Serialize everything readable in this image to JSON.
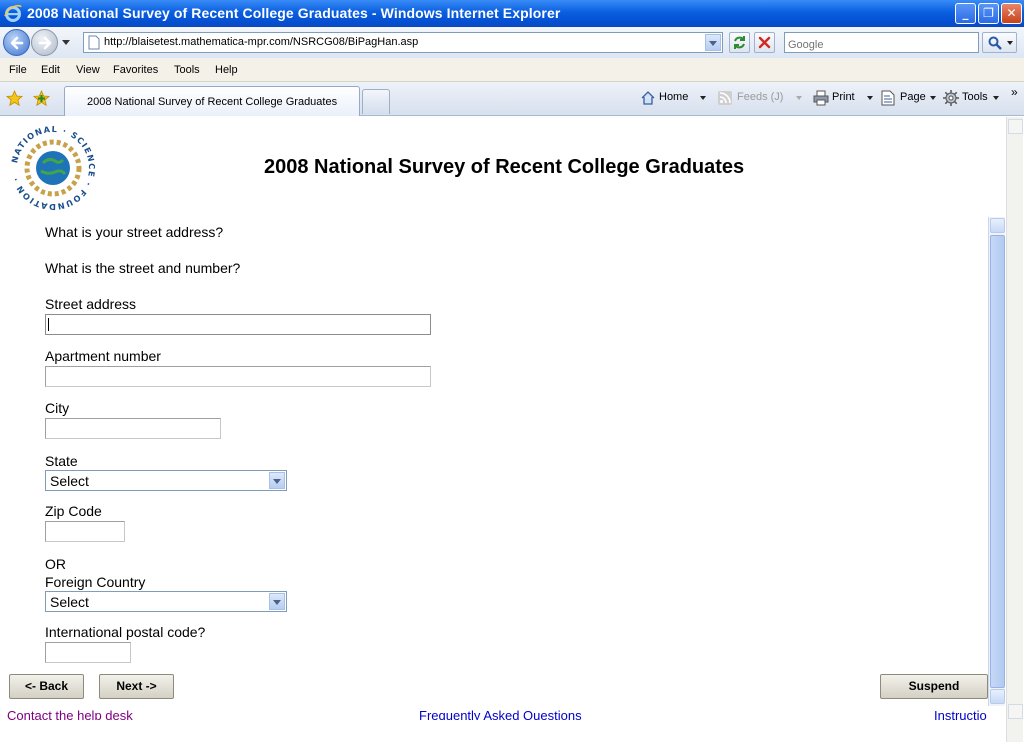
{
  "window": {
    "title": "2008 National Survey of Recent College Graduates - Windows Internet Explorer",
    "controls": {
      "minimize": "_",
      "maximize": "❐",
      "close": "✕"
    }
  },
  "address_bar": {
    "url": "http://blaisetest.mathematica-mpr.com/NSRCG08/BiPagHan.asp",
    "search_placeholder": "Google"
  },
  "menu": [
    "File",
    "Edit",
    "View",
    "Favorites",
    "Tools",
    "Help"
  ],
  "tabs": {
    "active_title": "2008 National Survey of Recent College Graduates"
  },
  "commands": {
    "home": "Home",
    "feeds": "Feeds (J)",
    "print": "Print",
    "page": "Page",
    "tools": "Tools",
    "more": "»"
  },
  "page": {
    "logo_text": "NATIONAL SCIENCE FOUNDATION",
    "title": "2008 National Survey of Recent College Graduates",
    "question": "What is your street address?",
    "subquestion": "What is the street and number?",
    "fields": {
      "street_label": "Street address",
      "street_value": "",
      "apartment_label": "Apartment number",
      "apartment_value": "",
      "city_label": "City",
      "city_value": "",
      "state_label": "State",
      "state_value": "Select",
      "zip_label": "Zip Code",
      "zip_value": "",
      "or_text": "OR",
      "country_label": "Foreign Country",
      "country_value": "Select",
      "postal_label": "International postal code?",
      "postal_value": ""
    },
    "buttons": {
      "back": "<- Back",
      "next": "Next ->",
      "suspend": "Suspend"
    },
    "footer_links": {
      "help": "Contact the help desk",
      "faq": "Frequently Asked Questions",
      "instructions": "Instructio"
    }
  },
  "colors": {
    "titlebar": "#0a5fe0",
    "visited_link": "#800080",
    "link": "#0000cc"
  }
}
